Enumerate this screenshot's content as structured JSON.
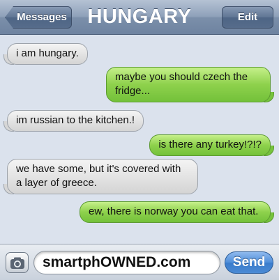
{
  "nav": {
    "back_label": "Messages",
    "title": "HUNGARY",
    "edit_label": "Edit"
  },
  "messages": [
    {
      "direction": "incoming",
      "text": "i am hungary."
    },
    {
      "direction": "outgoing",
      "text": "maybe you should czech the fridge..."
    },
    {
      "direction": "incoming",
      "text": "im russian to the kitchen.!"
    },
    {
      "direction": "outgoing",
      "text": "is there any turkey!?!?"
    },
    {
      "direction": "incoming",
      "text": "we have some, but it's covered with a layer of greece."
    },
    {
      "direction": "outgoing",
      "text": "ew, there is norway you can eat that."
    }
  ],
  "input": {
    "camera_icon": "camera-icon",
    "value": "smartphOWNED.com",
    "send_label": "Send"
  },
  "colors": {
    "incoming_bubble": "#e2e2e2",
    "outgoing_bubble": "#8ed14c",
    "navbar": "#8fa1ba",
    "send_button": "#4f8ed9"
  }
}
